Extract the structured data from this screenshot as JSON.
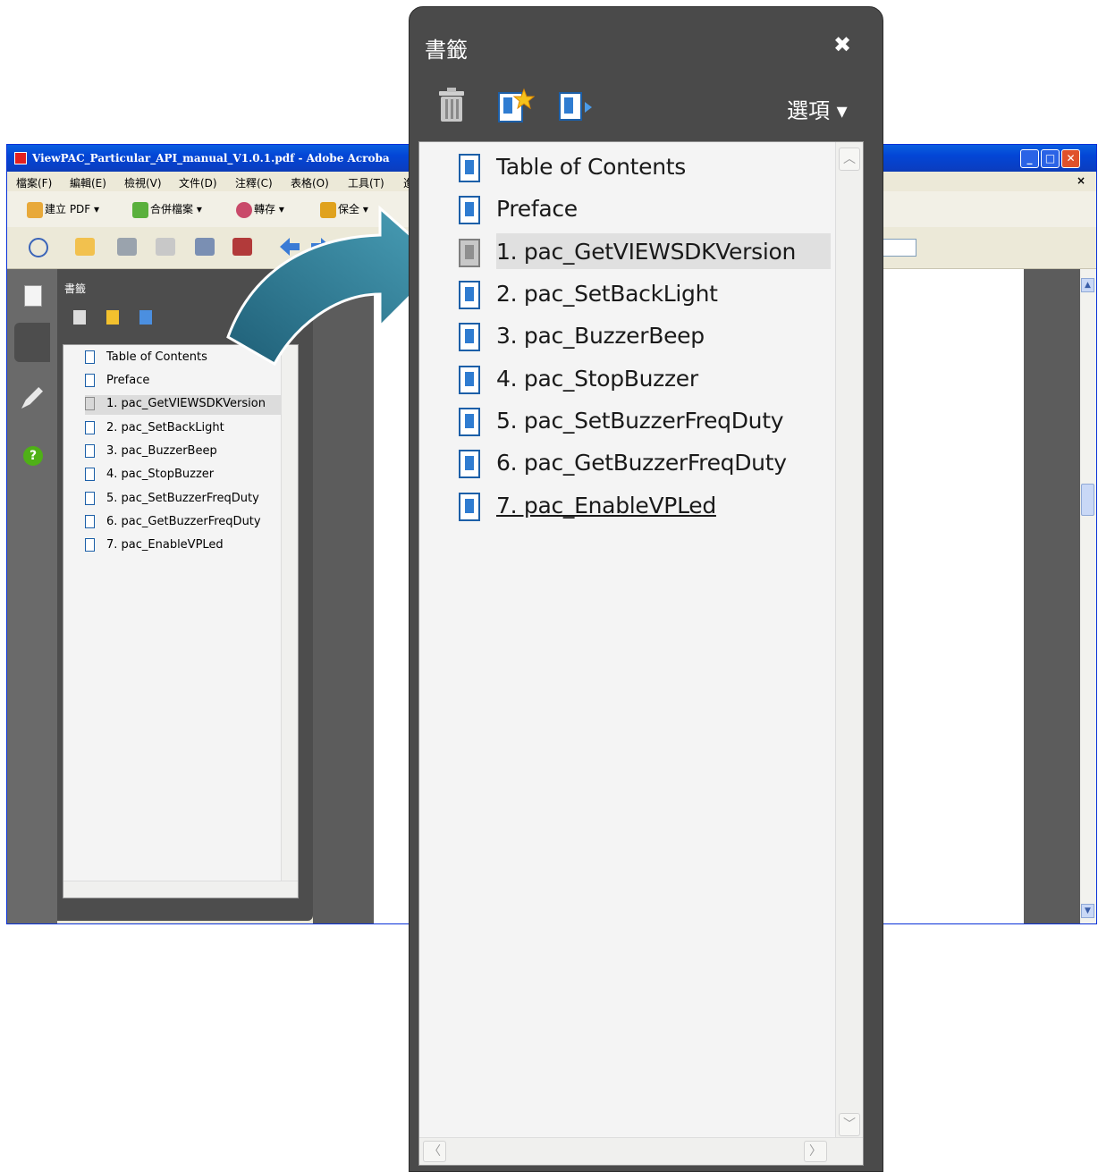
{
  "window": {
    "title": "ViewPAC_Particular_API_manual_V1.0.1.pdf - Adobe Acroba",
    "controls": {
      "minimize": "_",
      "maximize": "□",
      "close": "✕"
    }
  },
  "menu": {
    "items": [
      "檔案(F)",
      "編輯(E)",
      "檢視(V)",
      "文件(D)",
      "注釋(C)",
      "表格(O)",
      "工具(T)",
      "進"
    ],
    "doc_close": "×"
  },
  "toolbar": {
    "create_pdf": "建立 PDF ▾",
    "combine": "合併檔案 ▾",
    "export": "轉存 ▾",
    "secure": "保全 ▾"
  },
  "nav_panel": {
    "title": "書籤",
    "bookmarks": [
      {
        "label": "Table of Contents",
        "icon": "bookmark-icon"
      },
      {
        "label": "Preface",
        "icon": "bookmark-icon"
      },
      {
        "label": "1.  pac_GetVIEWSDKVersion",
        "icon": "bookmark-gray-icon",
        "selected": true
      },
      {
        "label": "2.  pac_SetBackLight",
        "icon": "bookmark-icon"
      },
      {
        "label": "3.  pac_BuzzerBeep",
        "icon": "bookmark-icon"
      },
      {
        "label": "4.  pac_StopBuzzer",
        "icon": "bookmark-icon"
      },
      {
        "label": "5.  pac_SetBuzzerFreqDuty",
        "icon": "bookmark-icon"
      },
      {
        "label": "6.  pac_GetBuzzerFreqDuty",
        "icon": "bookmark-icon"
      },
      {
        "label": "7.  pac_EnableVPLed",
        "icon": "bookmark-icon",
        "hover": true
      }
    ]
  },
  "zoom_panel": {
    "title": "書籤",
    "close": "✖",
    "options": "選項 ▾"
  },
  "colors": {
    "panel_bg": "#4a4a4a",
    "list_bg": "#f4f4f4",
    "selected_bg": "#e0e0e0",
    "bookmark_blue": "#1c5fa8",
    "arrow_teal": "#2f7e98",
    "xp_title_blue": "#0a5fe0"
  }
}
